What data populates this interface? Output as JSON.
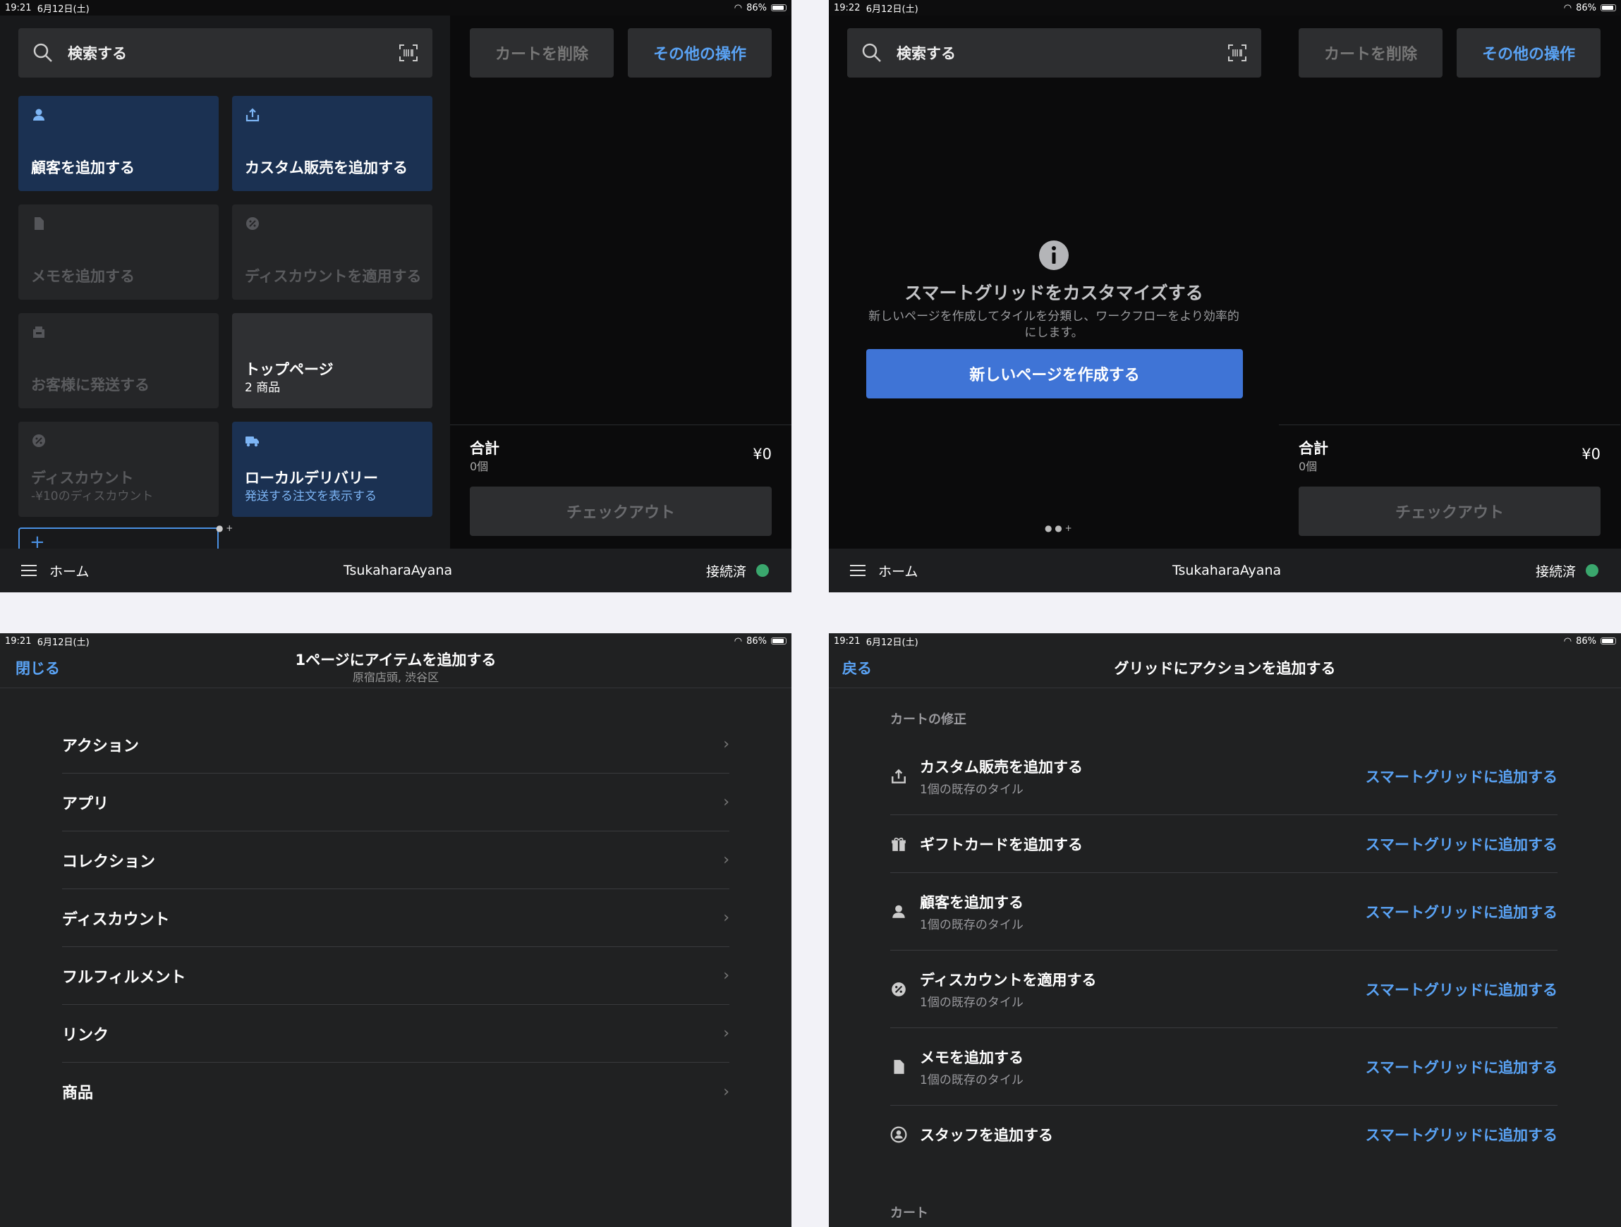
{
  "status": {
    "p1_time": "19:21",
    "p1_date": "6月12日(土)",
    "p2_time": "19:22",
    "p2_date": "6月12日(土)",
    "p3_time": "19:21",
    "p3_date": "6月12日(土)",
    "p4_time": "19:21",
    "p4_date": "6月12日(土)",
    "battery": "86%"
  },
  "pos": {
    "search_placeholder": "検索する",
    "tiles": {
      "add_customer": "顧客を追加する",
      "add_custom_sale": "カスタム販売を追加する",
      "add_memo": "メモを追加する",
      "apply_discount": "ディスカウントを適用する",
      "ship_to_customer": "お客様に発送する",
      "top_page": "トップページ",
      "top_page_sub": "2 商品",
      "discount": "ディスカウント",
      "discount_sub": "-¥10のディスカウント",
      "local_delivery": "ローカルデリバリー",
      "local_delivery_sub": "発送する注文を表示する"
    },
    "clear_cart": "カートを削除",
    "more_actions": "その他の操作",
    "total_label": "合計",
    "total_count": "0個",
    "total_amount": "¥0",
    "checkout": "チェックアウト",
    "menu_label": "ホーム",
    "user": "TsukaharaAyana",
    "connection": "接続済"
  },
  "empty_page": {
    "title": "スマートグリッドをカスタマイズする",
    "desc": "新しいページを作成してタイルを分類し、ワークフローをより効率的にします。",
    "create_button": "新しいページを作成する"
  },
  "add_item": {
    "close": "閉じる",
    "title": "1ページにアイテムを追加する",
    "subtitle": "原宿店頭, 渋谷区",
    "items": [
      "アクション",
      "アプリ",
      "コレクション",
      "ディスカウント",
      "フルフィルメント",
      "リンク",
      "商品"
    ]
  },
  "add_action": {
    "back": "戻る",
    "title": "グリッドにアクションを追加する",
    "section1": "カートの修正",
    "section2": "カート",
    "link_label": "スマートグリッドに追加する",
    "rows": [
      {
        "title": "カスタム販売を追加する",
        "sub": "1個の既存のタイル",
        "icon": "upload-tray-icon"
      },
      {
        "title": "ギフトカードを追加する",
        "sub": "",
        "icon": "gift-icon"
      },
      {
        "title": "顧客を追加する",
        "sub": "1個の既存のタイル",
        "icon": "person-icon"
      },
      {
        "title": "ディスカウントを適用する",
        "sub": "1個の既存のタイル",
        "icon": "discount-icon"
      },
      {
        "title": "メモを追加する",
        "sub": "1個の既存のタイル",
        "icon": "document-icon"
      },
      {
        "title": "スタッフを追加する",
        "sub": "",
        "icon": "staff-icon"
      }
    ]
  }
}
